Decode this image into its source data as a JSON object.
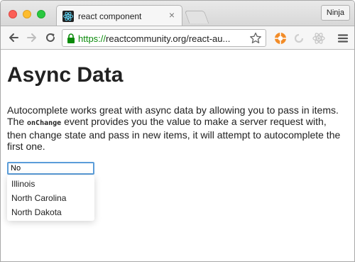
{
  "tab": {
    "title": "react component",
    "close": "×"
  },
  "profile": {
    "label": "Ninja"
  },
  "omnibox": {
    "scheme": "https://",
    "host": "reactcommunity.org/react-au..."
  },
  "page": {
    "title": "Async Data",
    "intro_before": "Autocomplete works great with async data by allowing you to pass in items. The ",
    "intro_code": "onChange",
    "intro_after": " event provides you the value to make a server request with, then change state and pass in new items, it will attempt to autocomplete the first one."
  },
  "autocomplete": {
    "value": "No",
    "items": [
      "Illinois",
      "North Carolina",
      "North Dakota"
    ]
  },
  "colors": {
    "secure": "#0b8a0b",
    "focus_ring": "#5b9dd9"
  },
  "icons": [
    "react-favicon",
    "back-arrow-icon",
    "forward-arrow-icon",
    "reload-icon",
    "lock-icon",
    "bookmark-star-icon",
    "extension-orange-icon",
    "extension-grey-icon",
    "react-devtools-icon",
    "menu-icon"
  ]
}
